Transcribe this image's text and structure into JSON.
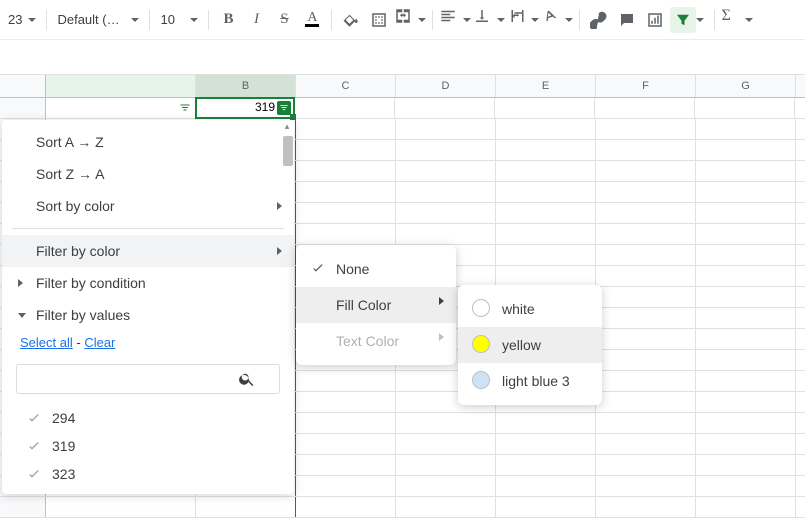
{
  "toolbar": {
    "zoom": "23",
    "font": "Default (Ari...",
    "font_size": "10"
  },
  "columns": [
    "",
    "B",
    "C",
    "D",
    "E",
    "F",
    "G"
  ],
  "active_cell_value": "319",
  "filter_menu": {
    "sort_az": "Sort A → Z",
    "sort_za": "Sort Z → A",
    "sort_by_color": "Sort by color",
    "filter_by_color": "Filter by color",
    "filter_by_condition": "Filter by condition",
    "filter_by_values": "Filter by values",
    "select_all": "Select all",
    "dash": " - ",
    "clear": "Clear",
    "search_placeholder": "",
    "values": [
      "294",
      "319",
      "323"
    ]
  },
  "submenu_color": {
    "none": "None",
    "fill": "Fill Color",
    "text": "Text Color"
  },
  "submenu_fill": [
    {
      "label": "white",
      "color": "#ffffff"
    },
    {
      "label": "yellow",
      "color": "#ffff00"
    },
    {
      "label": "light blue 3",
      "color": "#cfe2f3"
    }
  ]
}
